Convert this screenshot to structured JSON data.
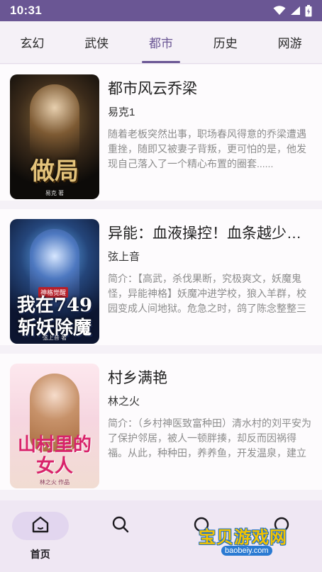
{
  "status_bar": {
    "time": "10:31",
    "icons": [
      "wifi-icon",
      "signal-icon",
      "battery-icon"
    ],
    "background": "#6a5694"
  },
  "tabs": [
    {
      "label": "玄幻",
      "active": false
    },
    {
      "label": "武侠",
      "active": false
    },
    {
      "label": "都市",
      "active": true
    },
    {
      "label": "历史",
      "active": false
    },
    {
      "label": "网游",
      "active": false
    }
  ],
  "books": [
    {
      "title": "都市风云乔梁",
      "author": "易克1",
      "description": "随着老板突然出事，职场春风得意的乔梁遭遇重挫，随即又被妻子背叛，更可怕的是，他发现自己落入了一个精心布置的圈套......",
      "cover": {
        "title": "做局",
        "author_line": "易克 著"
      }
    },
    {
      "title": "异能：血液操控！血条越少越强",
      "author": "弦上音",
      "description": "简介：【高武，杀伐果断，究极爽文，妖魔鬼怪，异能神格】妖魔冲进学校，狼入羊群，校园变成人间地狱。危急之时，鸽了陈念整整三",
      "cover": {
        "title": "我在749斩妖除魔",
        "tag": "神格觉醒",
        "author_line": "弦上音 著"
      }
    },
    {
      "title": "村乡满艳",
      "author": "林之火",
      "description": "简介：（乡村神医致富种田）清水村的刘平安为了保护邻居，被人一顿胖揍，却反而因祸得福。从此，种种田，养养鱼，开发温泉，建立",
      "cover": {
        "title": "山村里的女人",
        "author_line": "林之火 作品"
      }
    }
  ],
  "bottom_nav": [
    {
      "label": "首页",
      "icon": "home-icon",
      "active": true
    },
    {
      "label": "",
      "icon": "search-icon",
      "active": false
    },
    {
      "label": "",
      "icon": "bookshelf-icon",
      "active": false
    },
    {
      "label": "",
      "icon": "profile-icon",
      "active": false
    }
  ],
  "watermark": {
    "text": "宝贝游戏网",
    "url": "baobeiy.com"
  },
  "colors": {
    "accent": "#6a5694",
    "background": "#f5f1f7",
    "card": "#fdfbfd",
    "nav": "#efe7f3"
  }
}
